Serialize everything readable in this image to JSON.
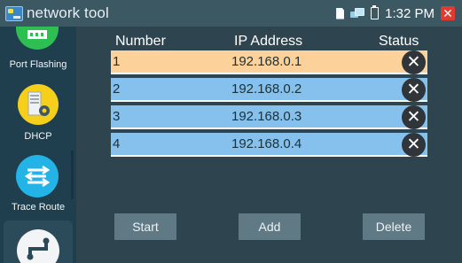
{
  "statusbar": {
    "app_title": "network tool",
    "time": "1:32 PM",
    "icons": [
      "app-icon",
      "sd-card-icon",
      "network-icon",
      "battery-icon",
      "close-icon"
    ]
  },
  "sidebar": {
    "items": [
      {
        "label": "Port Flashing",
        "icon": "port-flashing-icon"
      },
      {
        "label": "DHCP",
        "icon": "dhcp-icon"
      },
      {
        "label": "Trace Route",
        "icon": "trace-route-icon"
      },
      {
        "label": "",
        "icon": "route-path-icon"
      }
    ]
  },
  "table": {
    "headers": {
      "number": "Number",
      "ip": "IP Address",
      "status": "Status"
    },
    "rows": [
      {
        "number": "1",
        "ip": "192.168.0.1",
        "status_icon": "delete-x-icon",
        "selected": true
      },
      {
        "number": "2",
        "ip": "192.168.0.2",
        "status_icon": "delete-x-icon",
        "selected": false
      },
      {
        "number": "3",
        "ip": "192.168.0.3",
        "status_icon": "delete-x-icon",
        "selected": false
      },
      {
        "number": "4",
        "ip": "192.168.0.4",
        "status_icon": "delete-x-icon",
        "selected": false
      }
    ]
  },
  "buttons": {
    "start": "Start",
    "add": "Add",
    "delete": "Delete"
  },
  "colors": {
    "row_selected": "#fcd19a",
    "row_normal": "#85c1ec",
    "accent_yellow": "#f5cf1a",
    "accent_cyan": "#23b3e6",
    "close_red": "#e23a2e"
  }
}
